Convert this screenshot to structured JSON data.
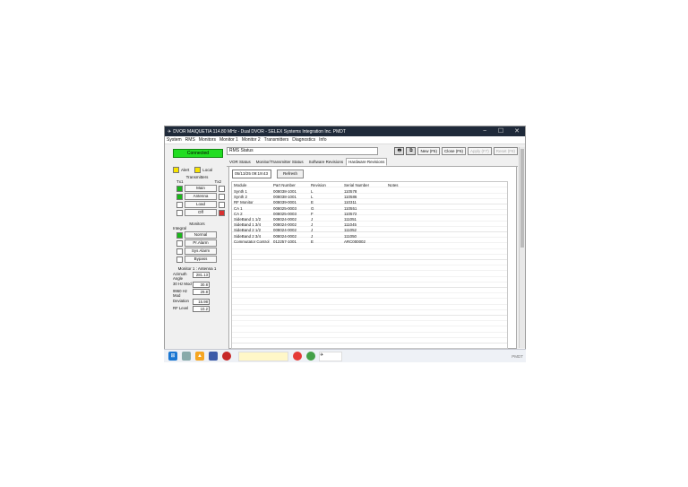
{
  "window": {
    "title": "DVOR MAIQUETIA 114.80 MHz - Dual DVOR - SELEX Systems Integration Inc. PMDT",
    "min": "−",
    "max": "☐",
    "close": "✕"
  },
  "menu": [
    "System",
    "RMS",
    "Monitors",
    "Monitor 1",
    "Monitor 2",
    "Transmitters",
    "Diagnostics",
    "Info"
  ],
  "left": {
    "connected": "Connected",
    "alert": "Alert",
    "local": "Local",
    "transmitters": "Transmitters",
    "tx1": "Tx1",
    "tx2": "Tx2",
    "main": "Main",
    "antenna": "Antenna",
    "load": "Load",
    "off": "Off",
    "monitors": "Monitors",
    "integral": "Integral",
    "normal": "Normal",
    "prealarm": "Pr.Alarm",
    "sysalarm": "Sys Alarm",
    "bypass": "Bypass",
    "monitor_header": "Monitor 1 : Antenna 1",
    "readings": [
      {
        "k": "Azimuth Angle",
        "v": "281.13"
      },
      {
        "k": "30 Hz Mod",
        "v": "30.8"
      },
      {
        "k": "9960 Hz Mod",
        "v": "29.8"
      },
      {
        "k": "Deviation",
        "v": "15.98"
      },
      {
        "k": "RF Level",
        "v": "10.2"
      }
    ]
  },
  "status_field": "RMS Status",
  "toolbar": {
    "print": "🖶",
    "copy": "⧉",
    "new": "New (F5)",
    "close": "Close (F6)",
    "apply": "Apply (F7)",
    "reset": "Reset (F8)"
  },
  "tabs": [
    "VOR Status",
    "Monitor/Transmitter Status",
    "Software Revisions",
    "Hardware Revisions"
  ],
  "panel": {
    "datetime": "05/13/25 09:19:43",
    "refresh": "Refresh"
  },
  "table": {
    "headers": [
      "Module",
      "Part Number",
      "Revision",
      "Serial Number",
      "Notes"
    ],
    "rows": [
      [
        "Synth 1",
        "008038-1001",
        "L",
        "110578",
        ""
      ],
      [
        "Synth 2",
        "008038-1001",
        "L",
        "110586",
        ""
      ],
      [
        "RF Monitor",
        "008039-0001",
        "E",
        "110311",
        ""
      ],
      [
        "CA 1",
        "008025-0003",
        "G",
        "110551",
        ""
      ],
      [
        "CA 2",
        "008025-0003",
        "F",
        "110572",
        ""
      ],
      [
        "SideBand 1 1/2",
        "008024-0002",
        "J",
        "111051",
        ""
      ],
      [
        "SideBand 1 3/4",
        "008024-0002",
        "J",
        "111045",
        ""
      ],
      [
        "SideBand 2 1/2",
        "008024-0002",
        "J",
        "111052",
        ""
      ],
      [
        "SideBand 2 3/4",
        "008024-0002",
        "J",
        "111050",
        ""
      ],
      [
        "Commutator Control",
        "012257-1001",
        "E",
        "ARC000002",
        ""
      ]
    ]
  },
  "tray_text": "PMDT"
}
